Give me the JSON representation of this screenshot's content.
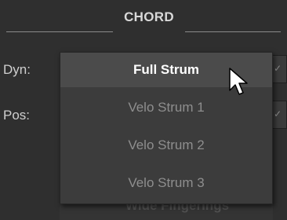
{
  "section": {
    "title": "CHORD"
  },
  "rows": {
    "dyn_label": "Dyn:",
    "pos_label": "Pos:"
  },
  "dropdown": {
    "items": [
      {
        "label": "Full Strum",
        "selected": true
      },
      {
        "label": "Velo Strum 1",
        "selected": false
      },
      {
        "label": "Velo Strum 2",
        "selected": false
      },
      {
        "label": "Velo Strum 3",
        "selected": false
      }
    ]
  },
  "background_control": {
    "label": "Wide Fingerings"
  },
  "icons": {
    "cursor": "mouse-pointer-icon",
    "chevron": "chevron-down-icon"
  },
  "colors": {
    "panel_bg": "#2f2f2f",
    "menu_bg": "#3c3c3c",
    "selected_bg": "#4b4b4b",
    "selected_text": "#ffffff",
    "item_text": "#8e8e8e"
  }
}
